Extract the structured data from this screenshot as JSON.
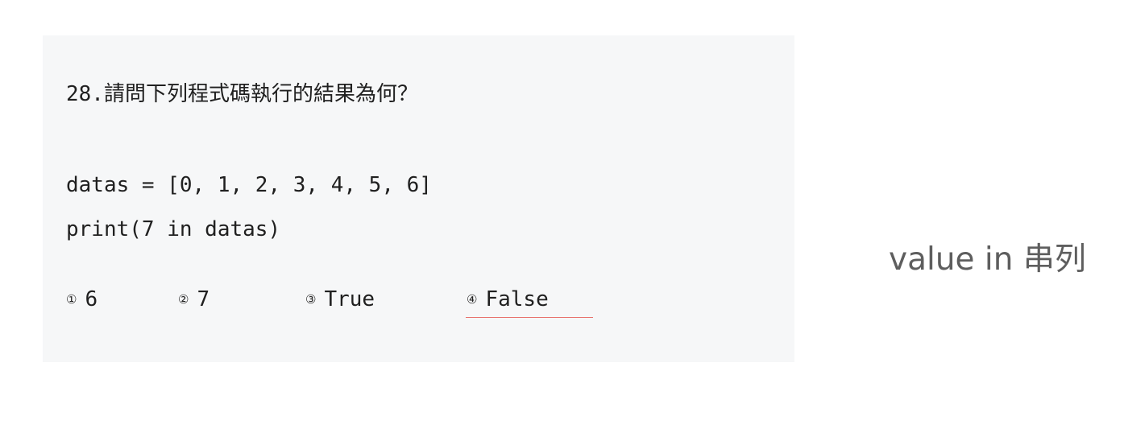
{
  "question": {
    "title": "28.請問下列程式碼執行的結果為何？",
    "code_lines": [
      "datas = [0, 1, 2, 3, 4, 5, 6]",
      "print(7 in datas)"
    ],
    "options": [
      {
        "mark": "①",
        "text": "6"
      },
      {
        "mark": "②",
        "text": "7"
      },
      {
        "mark": "③",
        "text": "True"
      },
      {
        "mark": "④",
        "text": "False"
      }
    ],
    "answer_accent_color": "#e8736f"
  },
  "side_note": "value in 串列"
}
